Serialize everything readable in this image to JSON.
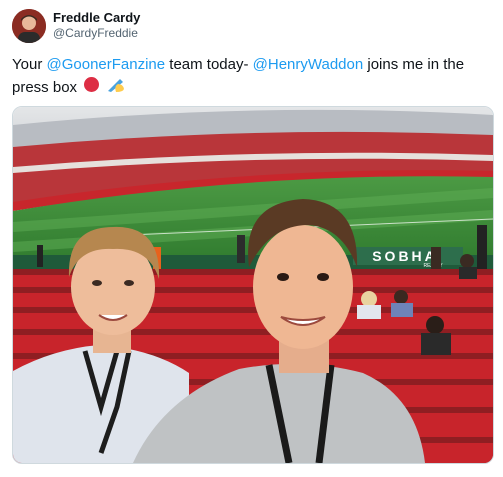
{
  "author": {
    "display_name": "Freddle Cardy",
    "handle": "@CardyFreddie",
    "avatar_icon": "profile-photo-avatar"
  },
  "tweet": {
    "text_before": "Your ",
    "mention_1": "@GoonerFanzine",
    "text_middle": " team today- ",
    "mention_2": "@HenryWaddon",
    "text_after": " joins me in the press box",
    "emoji_1": "red-circle",
    "emoji_2": "writing-hand"
  },
  "media": {
    "description_icon": "photo-stadium-selfie",
    "sponsor_sign": "SOBHA",
    "sponsor_sign_sub": "REALTY",
    "colors": {
      "seats": "#c0282d",
      "pitch": "#3e8a3a",
      "stands": "#d9d9d9"
    }
  }
}
